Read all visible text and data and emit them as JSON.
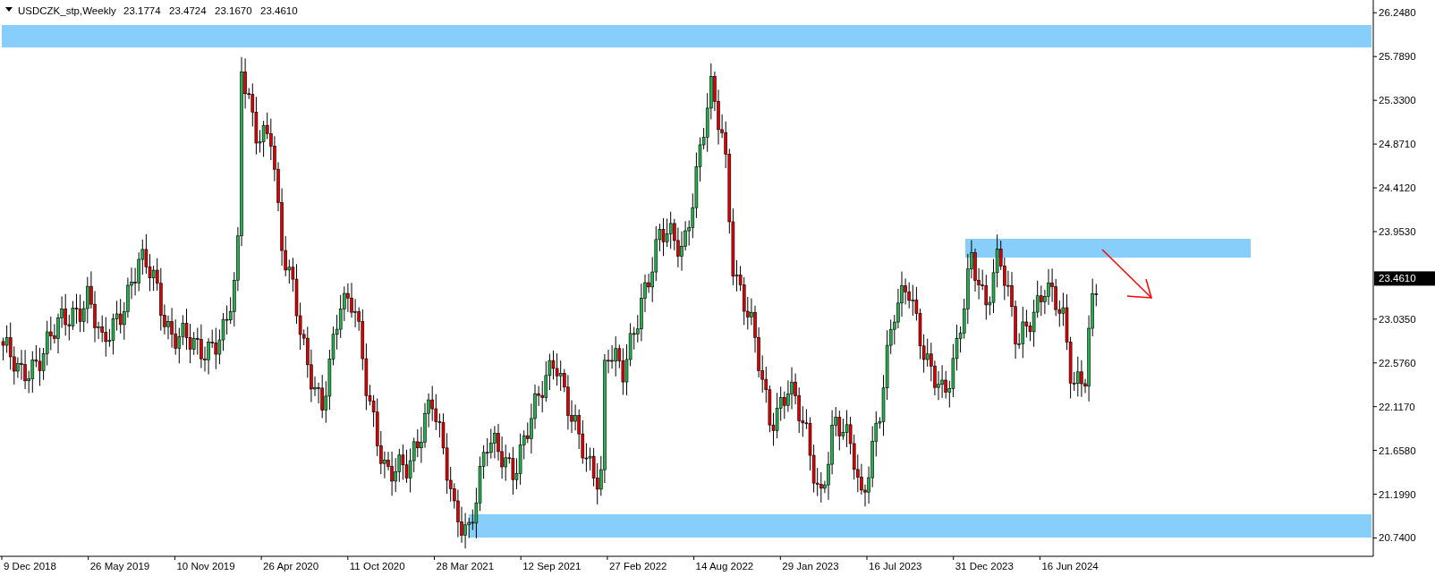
{
  "chart_header": {
    "symbol": "USDCZK_stp,Weekly",
    "values": [
      "23.1774",
      "23.4724",
      "23.1670",
      "23.4610"
    ]
  },
  "price_axis": {
    "labels": [
      "26.2480",
      "25.7890",
      "25.3300",
      "24.8710",
      "24.4120",
      "23.9530",
      "23.0350",
      "22.5760",
      "22.1170",
      "21.6580",
      "21.1990",
      "20.7400"
    ]
  },
  "current_price": "23.4610",
  "time_axis": {
    "labels": [
      "9 Dec 2018",
      "26 May 2019",
      "10 Nov 2019",
      "26 Apr 2020",
      "11 Oct 2020",
      "28 Mar 2021",
      "12 Sep 2021",
      "27 Feb 2022",
      "14 Aug 2022",
      "29 Jan 2023",
      "16 Jul 2023",
      "31 Dec 2023",
      "16 Jun 2024"
    ]
  }
}
